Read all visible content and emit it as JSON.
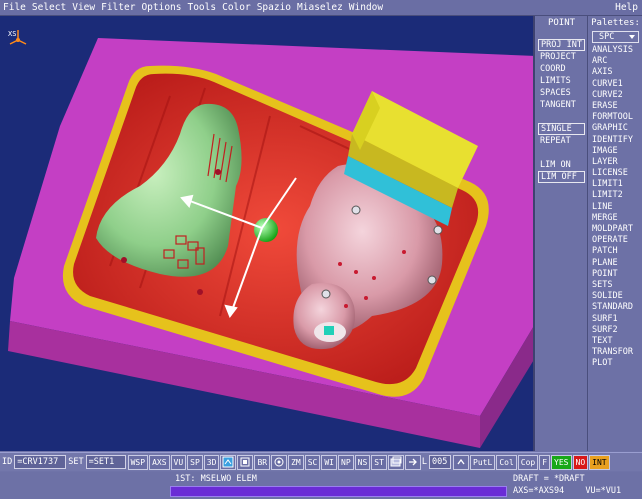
{
  "menubar": {
    "items": [
      "File",
      "Select",
      "View",
      "Filter",
      "Options",
      "Tools",
      "Color",
      "Spazio",
      "Miaselez",
      "Window"
    ],
    "help": "Help"
  },
  "viewport": {
    "axis_label": "XS"
  },
  "point_panel": {
    "title": "POINT",
    "items": [
      "PROJ INT",
      "PROJECT",
      "COORD",
      "LIMITS",
      "SPACES",
      "TANGENT",
      "SINGLE",
      "REPEAT",
      "LIM ON",
      "LIM OFF"
    ]
  },
  "palettes": {
    "title": "Palettes:",
    "selected": "SPC",
    "items": [
      "ANALYSIS",
      "ARC",
      "AXIS",
      "CURVE1",
      "CURVE2",
      "ERASE",
      "FORMTOOL",
      "GRAPHIC",
      "IDENTIFY",
      "IMAGE",
      "LAYER",
      "LICENSE",
      "LIMIT1",
      "LIMIT2",
      "LINE",
      "MERGE",
      "MOLDPART",
      "OPERATE",
      "PATCH",
      "PLANE",
      "POINT",
      "SETS",
      "SOLIDE",
      "STANDARD",
      "SURF1",
      "SURF2",
      "TEXT",
      "TRANSFOR",
      "PLOT"
    ]
  },
  "toolbar": {
    "id_label": "ID",
    "id_value": "=CRV1737",
    "set_label": "SET",
    "set_value": "=SET1",
    "buttons": [
      "WSP",
      "AXS",
      "VU",
      "SP",
      "3D"
    ],
    "buttons2": [
      "BR"
    ],
    "buttons3": [
      "ZM",
      "SC",
      "WI",
      "NP",
      "NS",
      "ST"
    ],
    "l_label": "L",
    "l_value": "005",
    "buttons4": [
      "PutL",
      "Col",
      "Cop",
      "F"
    ],
    "yes": "YES",
    "no": "NO",
    "int": "INT"
  },
  "status": {
    "message": "1ST: MSELWO ELEM",
    "draft": "DRAFT = *DRAFT",
    "axs": "AXS=*AXS94",
    "vu": "VU=*VU1"
  },
  "colors": {
    "viewport_bg": "#1b2b78",
    "mold_frame": "#c43fc4",
    "cavity": "#d42222",
    "rim": "#e6c21c",
    "part_green": "#8fcf8a",
    "part_pink": "#d99aa8",
    "insert_yellow": "#e8e030",
    "insert_cyan": "#30c0d8"
  }
}
